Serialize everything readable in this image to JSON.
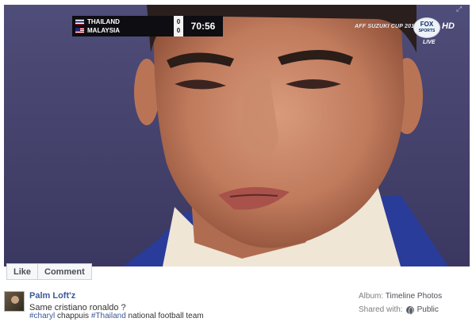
{
  "scorebug": {
    "team1": "THAILAND",
    "team2": "MALAYSIA",
    "score1": "0",
    "score2": "0",
    "clock": "70:56"
  },
  "broadcast": {
    "tournament": "AFF SUZUKI CUP 2014",
    "network_top": "FOX",
    "network_bottom": "SPORTS",
    "hd": "HD",
    "live": "LIVE"
  },
  "actions": {
    "like": "Like",
    "comment": "Comment"
  },
  "post": {
    "author": "Palm Loft'z",
    "caption": "Same cristiano ronaldo ?",
    "hashtag1": "#charyl",
    "text1": " chappuis ",
    "hashtag2": "#Thailand",
    "text2": " national football team"
  },
  "meta": {
    "album_label": "Album:",
    "album_value": "Timeline Photos",
    "shared_label": "Shared with:",
    "shared_value": "Public"
  },
  "colors": {
    "link": "#3b5998",
    "scorebug_bg": "#0d0d12",
    "backdrop": "#4a4873"
  }
}
